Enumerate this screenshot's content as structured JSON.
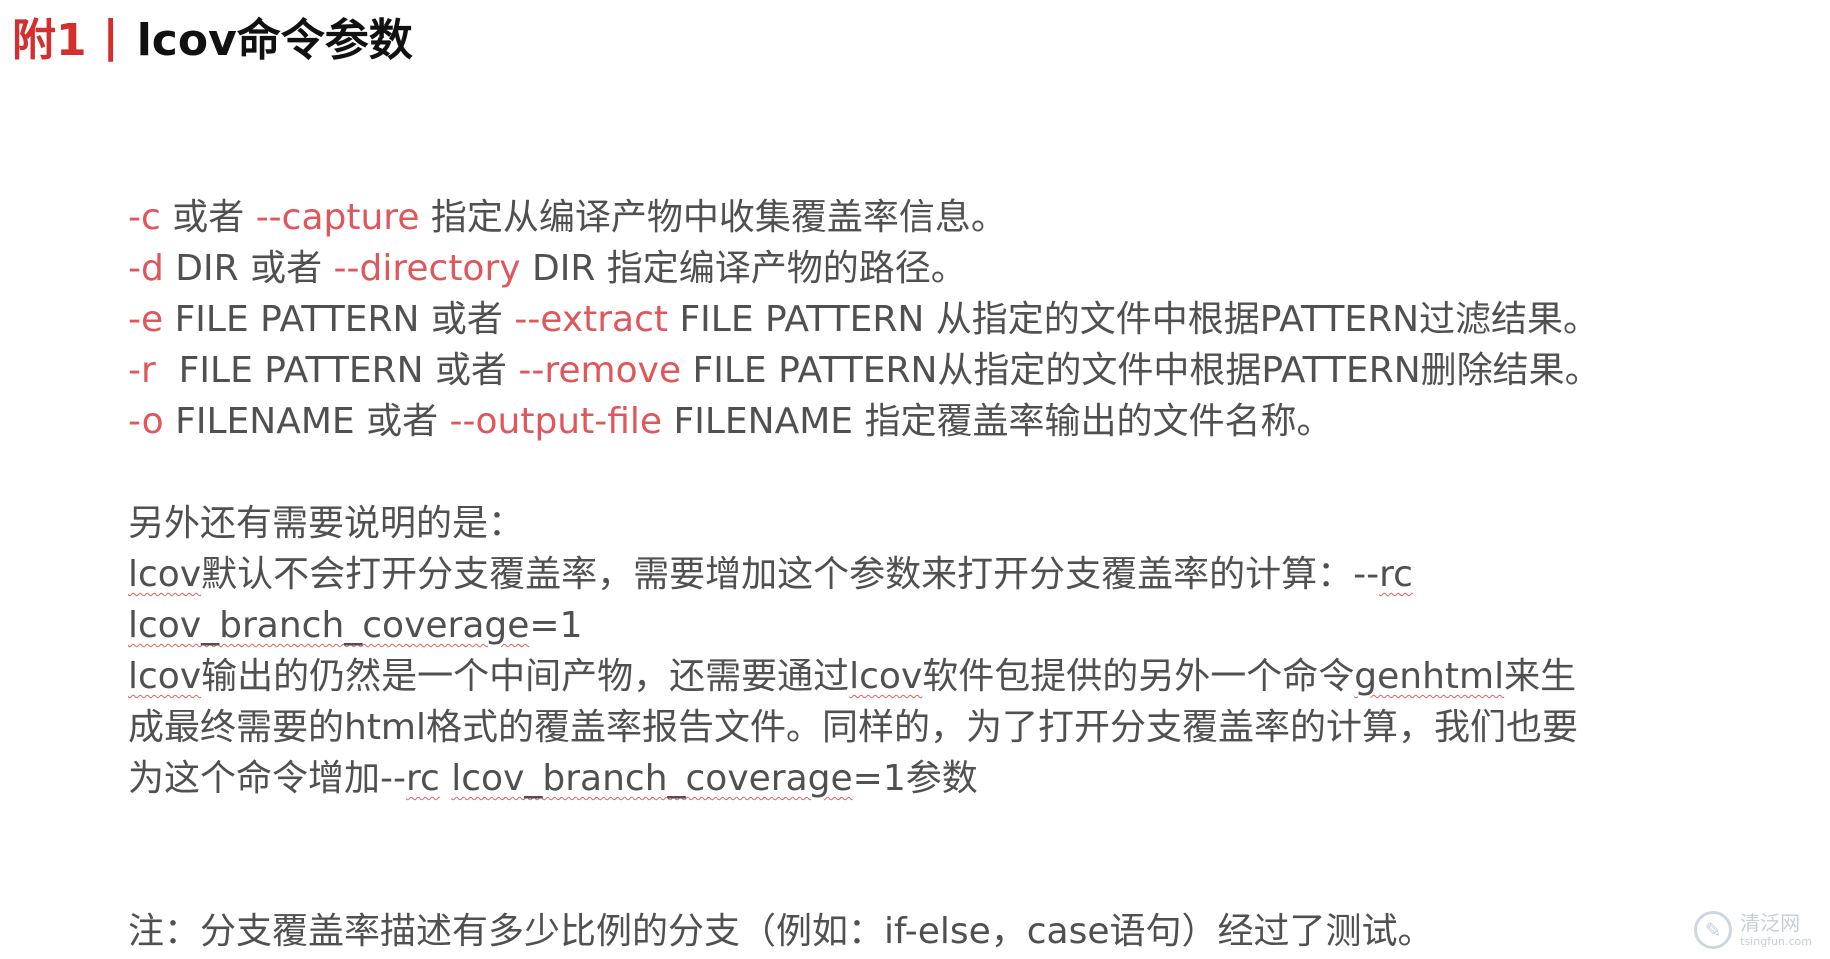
{
  "title": {
    "prefix": "附1",
    "divider": "|",
    "text": "lcov命令参数"
  },
  "options": [
    {
      "short": "-c",
      "mid": " 或者 ",
      "long": "--capture",
      "desc": " 指定从编译产物中收集覆盖率信息。"
    },
    {
      "short": "-d",
      "mid": " DIR 或者 ",
      "long": "--directory",
      "desc": " DIR 指定编译产物的路径。"
    },
    {
      "short": "-e",
      "mid": " FILE PATTERN 或者 ",
      "long": "--extract",
      "desc": " FILE PATTERN 从指定的文件中根据PATTERN过滤结果。"
    },
    {
      "short": "-r",
      "mid": "  FILE PATTERN 或者 ",
      "long": "--remove",
      "desc": " FILE PATTERN从指定的文件中根据PATTERN删除结果。"
    },
    {
      "short": "-o",
      "mid": " FILENAME 或者 ",
      "long": "--output-file",
      "desc": " FILENAME 指定覆盖率输出的文件名称。"
    }
  ],
  "notes": {
    "heading": "另外还有需要说明的是：",
    "line1_a": "lcov",
    "line1_b": "默认不会打开分支覆盖率，需要增加这个参数来打开分支覆盖率的计算：--",
    "line1_c": "rc",
    "line2_a": "lcov_branch_coverage",
    "line2_b": "=1",
    "line3_a": "lcov",
    "line3_b": "输出的仍然是一个中间产物，还需要通过",
    "line3_c": "lcov",
    "line3_d": "软件包提供的另外一个命令",
    "line3_e": "genhtml",
    "line3_f": "来生",
    "line4": "成最终需要的html格式的覆盖率报告文件。同样的，为了打开分支覆盖率的计算，我们也要",
    "line5_a": "为这个命令增加--",
    "line5_b": "rc",
    "line5_c": " ",
    "line5_d": "lcov_branch_coverage",
    "line5_e": "=1参数"
  },
  "footnote": "注：分支覆盖率描述有多少比例的分支（例如：if-else，case语句）经过了测试。",
  "watermark": {
    "cn": "清泛网",
    "en": "tsingfun.com"
  }
}
